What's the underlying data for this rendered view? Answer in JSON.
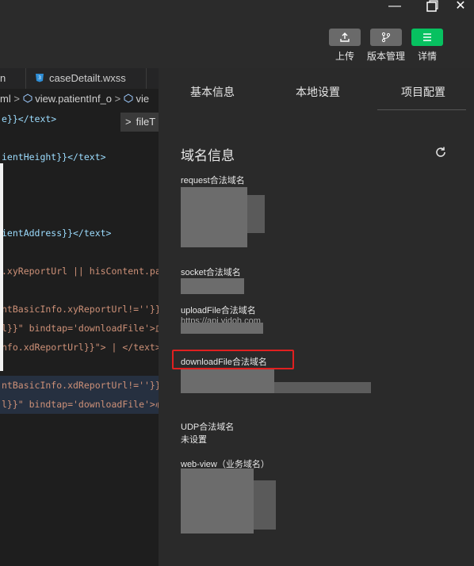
{
  "window": {
    "minimize": "—",
    "maximize": "❐",
    "close": "✕"
  },
  "toolbar": {
    "upload_label": "上传",
    "version_label": "版本管理",
    "details_label": "详情"
  },
  "editor": {
    "tabs": [
      {
        "label": "n"
      },
      {
        "label": "caseDetailt.wxss"
      }
    ],
    "breadcrumb": {
      "part1": "ml",
      "part2": "view.patientInf_o",
      "part3": "vie"
    },
    "popup_label": "fileT",
    "lines": {
      "l1": "e}}</text>",
      "l2": "ientHeight}}</text>",
      "l3": "ientAddress}}</text>",
      "l4": ".xyReportUrl || hisContent.pat",
      "l5": "ntBasicInfo.xyReportUrl!=''}}\"",
      "l6": "l}}\" bindtap='downloadFile'>血",
      "l7": "nfo.xdReportUrl}}\"> | </text>",
      "l8": "ntBasicInfo.xdReportUrl!=''}}\"",
      "l9": "l}}\" bindtap='downloadFile'>心"
    }
  },
  "details_panel": {
    "tabs": {
      "basic": "基本信息",
      "local": "本地设置",
      "project": "项目配置"
    },
    "section_title": "域名信息",
    "request_label": "request合法域名",
    "socket_label": "socket合法域名",
    "upload_label": "uploadFile合法域名",
    "upload_partial_value": "https://api.yidoh.com",
    "download_label": "downloadFile合法域名",
    "udp_label": "UDP合法域名",
    "udp_value": "未设置",
    "webview_label": "web-view（业务域名）"
  }
}
